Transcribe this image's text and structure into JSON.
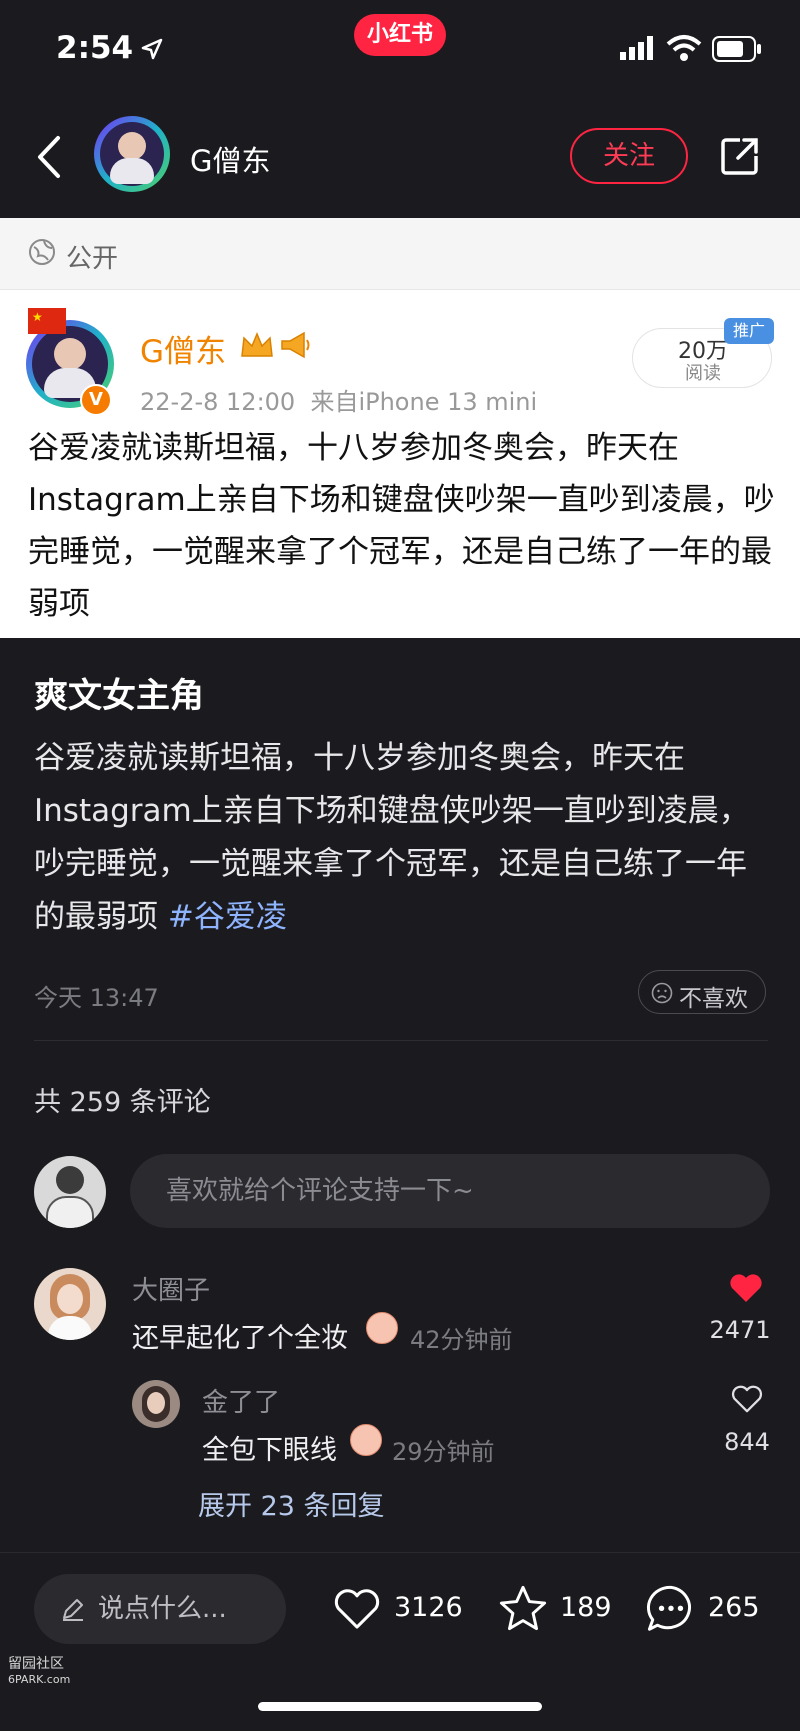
{
  "status": {
    "time": "2:54",
    "app_logo": "小红书"
  },
  "header": {
    "author": "G僧东",
    "follow_label": "关注",
    "back_icon": "chevron-left-icon",
    "share_icon": "share-icon"
  },
  "screenshot_card": {
    "visibility": "公开",
    "author": "G僧东",
    "date_source": "22-2-8 12:00  来自iPhone 13 mini",
    "reads_value": "20万",
    "reads_label": "阅读",
    "promo_badge": "推广",
    "text": "谷爱凌就读斯坦福，十八岁参加冬奥会，昨天在Instagram上亲自下场和键盘侠吵架一直吵到凌晨，吵完睡觉，一觉醒来拿了个冠军，还是自己练了一年的最弱项"
  },
  "note": {
    "title": "爽文女主角",
    "body": "谷爱凌就读斯坦福，十八岁参加冬奥会，昨天在Instagram上亲自下场和键盘侠吵架一直吵到凌晨，吵完睡觉，一觉醒来拿了个冠军，还是自己练了一年的最弱项 ",
    "hashtag": "#谷爱凌",
    "time": "今天 13:47",
    "dislike_label": "不喜欢"
  },
  "comments": {
    "total": "共 259 条评论",
    "input_placeholder": "喜欢就给个评论支持一下~",
    "items": [
      {
        "user": "大圈子",
        "text": "还早起化了个全妆",
        "time": "42分钟前",
        "likes": "2471",
        "liked": true
      },
      {
        "user": "金了了",
        "text": "全包下眼线",
        "time": "29分钟前",
        "likes": "844",
        "liked": false
      }
    ],
    "expand_label": "展开 23 条回复"
  },
  "bottom_bar": {
    "say_placeholder": "说点什么...",
    "likes": "3126",
    "stars": "189",
    "comments": "265"
  },
  "watermark": {
    "line1": "留园社区",
    "line2": "6PARK.com"
  },
  "colors": {
    "brand": "#ff2442",
    "background": "#1b1b1f",
    "hashtag": "#8fb4ff"
  }
}
